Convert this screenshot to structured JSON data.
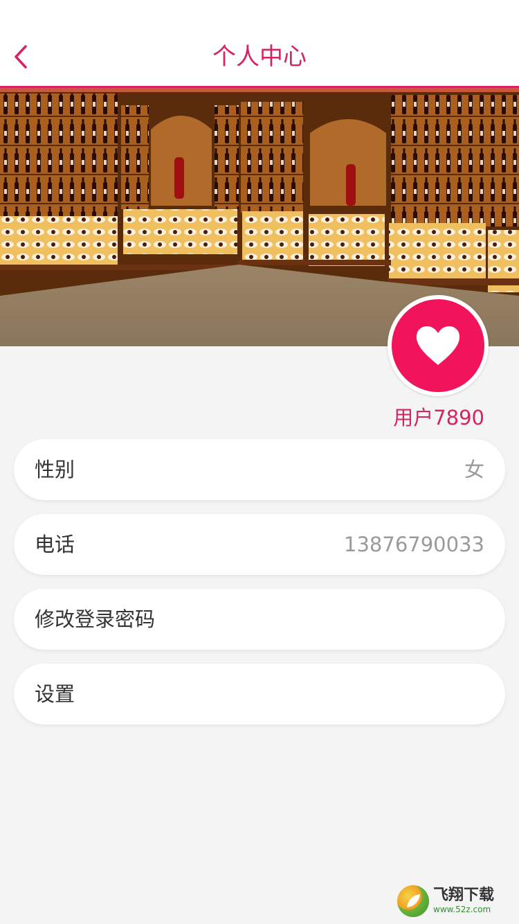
{
  "header": {
    "title": "个人中心",
    "back_icon": "chevron-left-icon"
  },
  "colors": {
    "accent": "#d8245e",
    "avatar_bg": "#f2145a",
    "background": "#f4f4f4"
  },
  "banner": {
    "image": "wine-cellar-photo"
  },
  "profile": {
    "avatar_icon": "heart-icon",
    "username": "用户7890"
  },
  "rows": [
    {
      "label": "性别",
      "value": "女"
    },
    {
      "label": "电话",
      "value": "13876790033"
    },
    {
      "label": "修改登录密码",
      "value": ""
    },
    {
      "label": "设置",
      "value": ""
    }
  ],
  "watermark": {
    "name": "飞翔下载",
    "url": "www.52z.com"
  }
}
